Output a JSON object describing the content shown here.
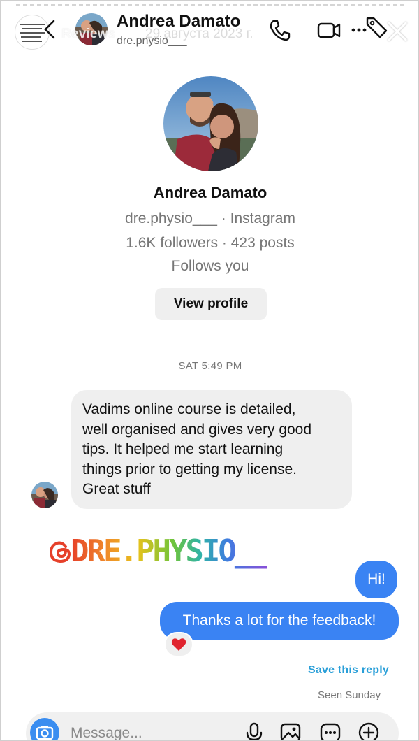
{
  "story": {
    "highlight_label": "Reviews",
    "date": "29 августа 2023 г."
  },
  "header": {
    "name": "Andrea Damato",
    "username": "dre.pnysio___",
    "icons": [
      "back-icon",
      "phone-icon",
      "video-icon",
      "tag-icon",
      "close-icon"
    ]
  },
  "profile": {
    "name": "Andrea Damato",
    "handle_line": "dre.physio___ · Instagram",
    "stats_line": "1.6K followers · 423 posts",
    "follows_line": "Follows you",
    "view_profile_label": "View profile"
  },
  "thread": {
    "timestamp": "SAT 5:49 PM",
    "incoming": {
      "lines": [
        "Vadims online course is detailed,",
        "well organised and gives very good",
        "tips.  It helped me start learning",
        "things prior to getting my license.",
        "Great stuff"
      ]
    },
    "sticker_text": "DRE.PHYSIO__",
    "outgoing": [
      {
        "text": "Hi!"
      },
      {
        "text": "Thanks a lot for the feedback!"
      }
    ],
    "reaction": "❤️",
    "save_reply_label": "Save this reply",
    "seen_label": "Seen Sunday"
  },
  "composer": {
    "placeholder": "Message...",
    "icons": [
      "camera-icon",
      "microphone-icon",
      "gallery-icon",
      "sticker-icon",
      "plus-icon"
    ]
  },
  "colors": {
    "outgoing_bubble": "#3a83f3",
    "incoming_bubble": "#efefef",
    "link": "#2a9fd8"
  }
}
